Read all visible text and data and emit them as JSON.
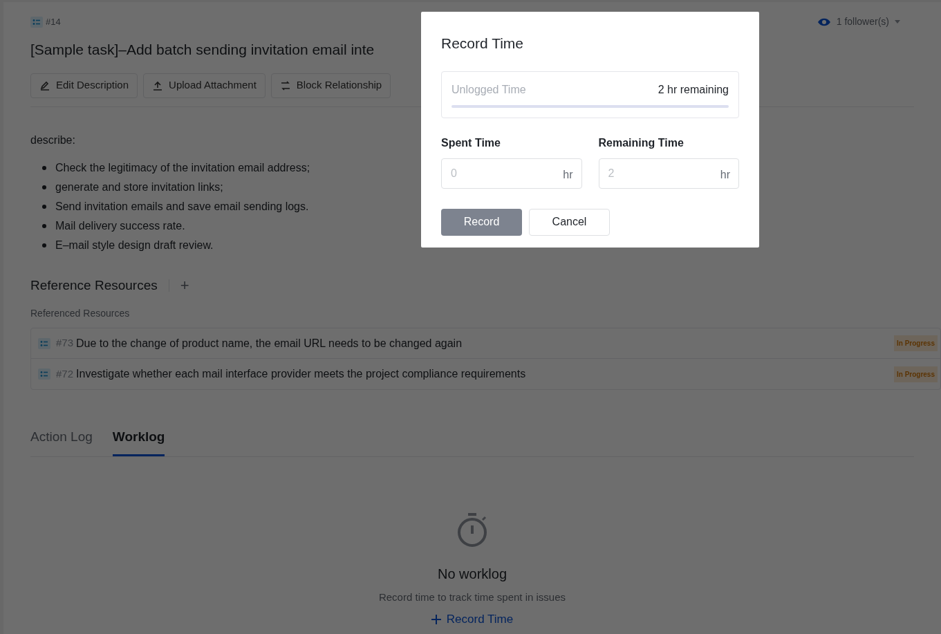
{
  "task": {
    "number": "#14",
    "title": "[Sample task]–Add batch sending invitation email inte",
    "followers": "1 follower(s)"
  },
  "toolbar": [
    "Edit Description",
    "Upload Attachment",
    "Block Relationship"
  ],
  "description": {
    "label": "describe:",
    "items": [
      "Check the legitimacy of the invitation email address;",
      "generate and store invitation links;",
      "Send invitation emails and save email sending logs.",
      "Mail delivery success rate.",
      "E–mail style design draft review."
    ]
  },
  "references": {
    "title": "Reference Resources",
    "add": "+",
    "subtitle": "Referenced Resources",
    "items": [
      {
        "number": "#73",
        "title": "Due to the change of product name, the email URL needs to be changed again",
        "status": "In Progress"
      },
      {
        "number": "#72",
        "title": "Investigate whether each mail interface provider meets the project compliance requirements",
        "status": "In Progress"
      }
    ]
  },
  "tabs": [
    {
      "label": "Action Log",
      "selected": false
    },
    {
      "label": "Worklog",
      "selected": true
    }
  ],
  "empty_state": {
    "title": "No worklog",
    "text": "Record time to track time spent in issues",
    "action": "Record Time"
  },
  "dialog": {
    "title": "Record Time",
    "unlogged_label": "Unlogged Time",
    "remaining_text": "2 hr remaining",
    "fields": [
      {
        "label": "Spent Time",
        "placeholder": "0",
        "unit": "hr"
      },
      {
        "label": "Remaining Time",
        "placeholder": "2",
        "unit": "hr"
      }
    ],
    "primary": "Record",
    "secondary": "Cancel"
  }
}
